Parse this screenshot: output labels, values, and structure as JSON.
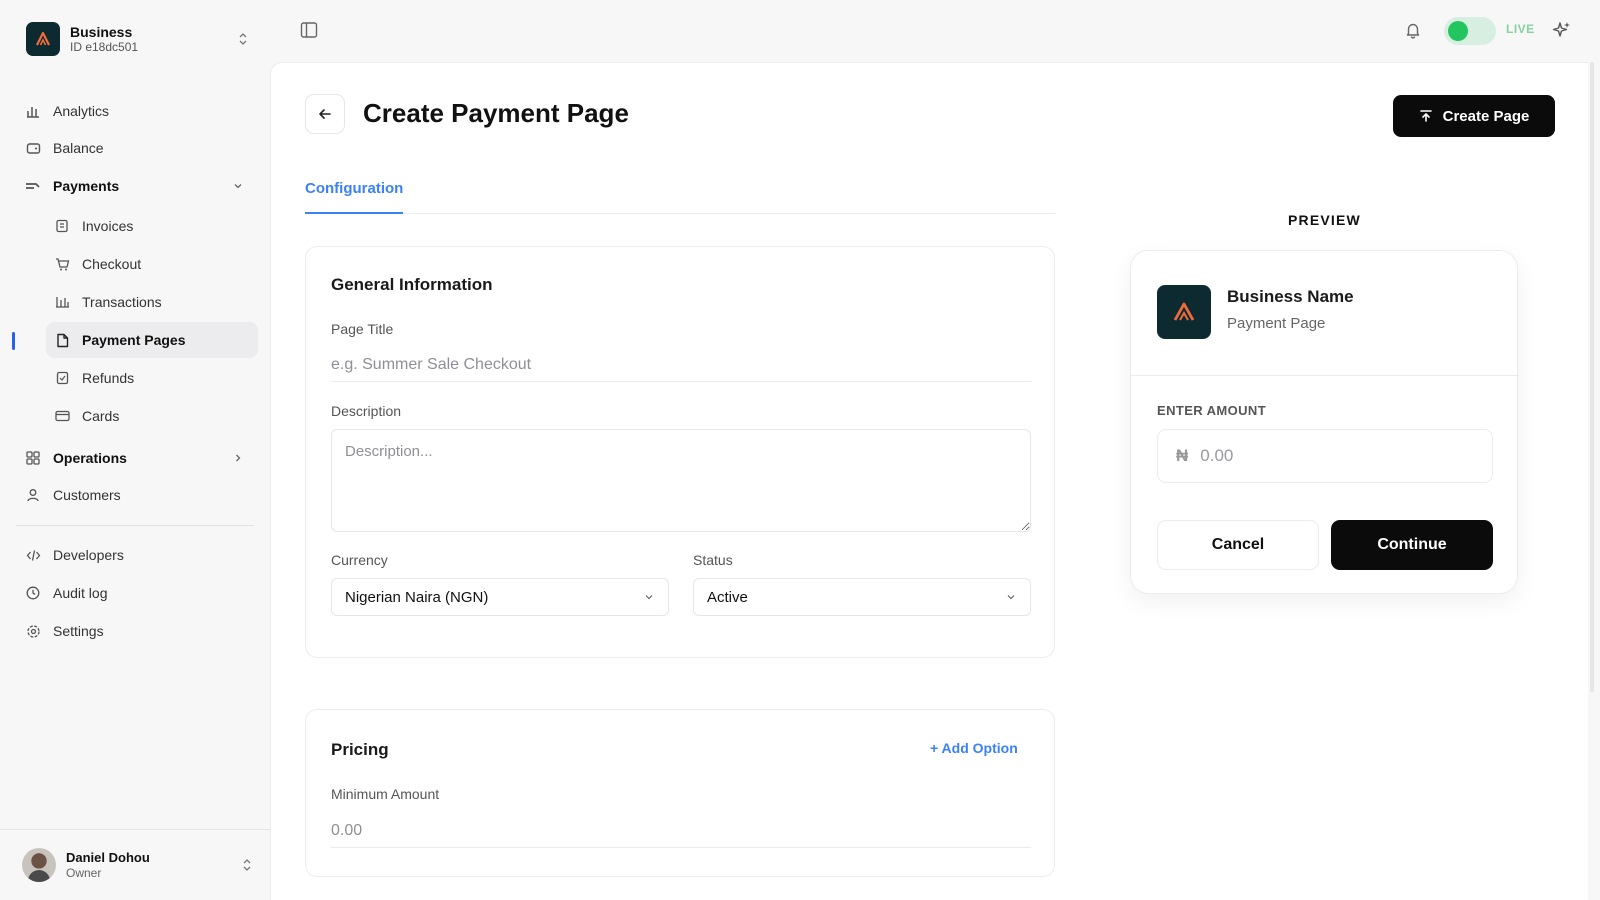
{
  "business": {
    "name": "Business",
    "id": "ID e18dc501"
  },
  "sidebar": {
    "items": [
      {
        "label": "Analytics",
        "icon": "bar-chart-icon"
      },
      {
        "label": "Balance",
        "icon": "wallet-icon"
      },
      {
        "label": "Payments",
        "icon": "payments-icon",
        "expanded": true
      },
      {
        "label": "Invoices",
        "icon": "invoice-icon"
      },
      {
        "label": "Checkout",
        "icon": "cart-icon"
      },
      {
        "label": "Transactions",
        "icon": "transactions-icon"
      },
      {
        "label": "Payment Pages",
        "icon": "page-icon",
        "active": true
      },
      {
        "label": "Refunds",
        "icon": "refund-icon"
      },
      {
        "label": "Cards",
        "icon": "card-icon"
      },
      {
        "label": "Operations",
        "icon": "grid-icon"
      },
      {
        "label": "Customers",
        "icon": "user-icon"
      },
      {
        "label": "Developers",
        "icon": "code-icon"
      },
      {
        "label": "Audit log",
        "icon": "clock-icon"
      },
      {
        "label": "Settings",
        "icon": "gear-icon"
      }
    ]
  },
  "user": {
    "name": "Daniel Dohou",
    "role": "Owner"
  },
  "topbar": {
    "mode_label": "LIVE",
    "live_enabled": true
  },
  "page": {
    "title": "Create Payment Page",
    "create_button": "Create Page",
    "tabs": [
      {
        "label": "Configuration",
        "active": true
      }
    ]
  },
  "general": {
    "heading": "General Information",
    "page_title_label": "Page Title",
    "page_title_placeholder": "e.g. Summer Sale Checkout",
    "description_label": "Description",
    "description_placeholder": "Description...",
    "currency_label": "Currency",
    "currency_value": "Nigerian Naira (NGN)",
    "status_label": "Status",
    "status_value": "Active"
  },
  "pricing": {
    "heading": "Pricing",
    "add_option": "+ Add Option",
    "min_amount_label": "Minimum Amount",
    "min_amount_placeholder": "0.00"
  },
  "preview": {
    "label": "PREVIEW",
    "business_name": "Business Name",
    "subtitle": "Payment Page",
    "amount_label": "ENTER AMOUNT",
    "currency_symbol": "₦",
    "amount_placeholder": "0.00",
    "cancel": "Cancel",
    "continue": "Continue"
  },
  "colors": {
    "accent": "#3b82f6",
    "brand_dark": "#0c2a30",
    "brand_orange": "#f26b3a",
    "live_green": "#22c55e"
  }
}
